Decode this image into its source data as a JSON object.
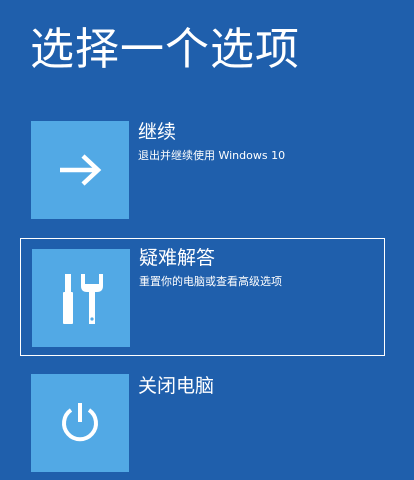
{
  "page": {
    "title": "选择一个选项"
  },
  "options": [
    {
      "label": "继续",
      "description": "退出并继续使用 Windows 10",
      "icon": "arrow-right-icon"
    },
    {
      "label": "疑难解答",
      "description": "重置你的电脑或查看高级选项",
      "icon": "tools-icon"
    },
    {
      "label": "关闭电脑",
      "description": "",
      "icon": "power-icon"
    }
  ],
  "colors": {
    "background": "#1f5fac",
    "tile": "#52a9e5",
    "text": "#ffffff"
  }
}
